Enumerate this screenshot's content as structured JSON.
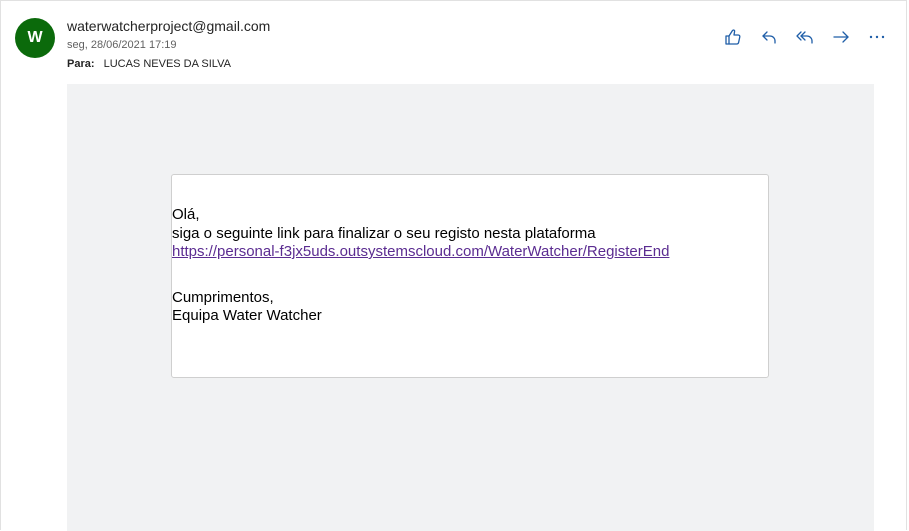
{
  "header": {
    "avatar_initial": "W",
    "sender": "waterwatcherproject@gmail.com",
    "date": "seg, 28/06/2021 17:19",
    "to_label": "Para:",
    "to_name": "LUCAS NEVES DA SILVA"
  },
  "actions": [
    {
      "icon": "thumbs-up-icon"
    },
    {
      "icon": "reply-icon"
    },
    {
      "icon": "reply-all-icon"
    },
    {
      "icon": "forward-icon"
    },
    {
      "icon": "more-icon"
    }
  ],
  "message": {
    "greeting": "Olá,",
    "line1": "siga o seguinte link para finalizar o seu registo nesta plataforma",
    "link": "https://personal-f3jx5uds.outsystemscloud.com/WaterWatcher/RegisterEnd",
    "closing": "Cumprimentos,",
    "signature": "Equipa Water Watcher"
  },
  "colors": {
    "avatar": "#0b6a0b",
    "accent_icon": "#1f5ea8",
    "link": "#5b2c91",
    "mail_background": "#f1f2f3"
  }
}
